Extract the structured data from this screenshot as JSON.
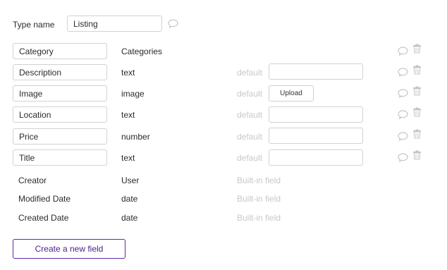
{
  "type_name": {
    "label": "Type name",
    "value": "Listing"
  },
  "default_label": "default",
  "upload_label": "Upload",
  "builtin_label": "Built-in field",
  "fields": [
    {
      "name": "Category",
      "type": "Categories"
    },
    {
      "name": "Description",
      "type": "text"
    },
    {
      "name": "Image",
      "type": "image"
    },
    {
      "name": "Location",
      "type": "text"
    },
    {
      "name": "Price",
      "type": "number"
    },
    {
      "name": "Title",
      "type": "text"
    }
  ],
  "builtin_fields": [
    {
      "name": "Creator",
      "type": "User"
    },
    {
      "name": "Modified Date",
      "type": "date"
    },
    {
      "name": "Created Date",
      "type": "date"
    }
  ],
  "create_button": "Create a new field",
  "icons": {
    "comment": "speech-bubble-icon",
    "delete": "trash-icon"
  },
  "colors": {
    "accent": "#5b2a9e",
    "muted": "#c8c8c8",
    "border": "#d2d2d2"
  }
}
